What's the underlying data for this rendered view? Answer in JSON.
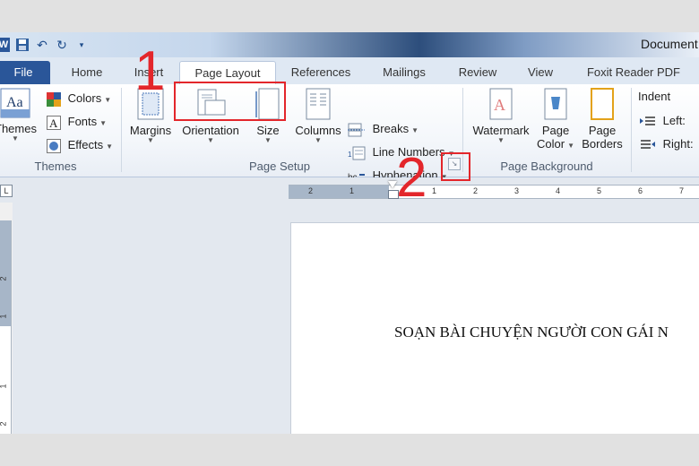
{
  "titlebar": {
    "document_title": "Document"
  },
  "qat": {
    "save_icon": "save-icon",
    "undo_icon": "undo-icon",
    "redo_icon": "redo-icon",
    "customize_icon": "customize-qat-icon"
  },
  "tabs": [
    {
      "label": "File"
    },
    {
      "label": "Home"
    },
    {
      "label": "Insert"
    },
    {
      "label": "Page Layout"
    },
    {
      "label": "References"
    },
    {
      "label": "Mailings"
    },
    {
      "label": "Review"
    },
    {
      "label": "View"
    },
    {
      "label": "Foxit Reader PDF"
    }
  ],
  "ribbon": {
    "themes": {
      "themes_label": "Themes",
      "colors_label": "Colors",
      "fonts_label": "Fonts",
      "effects_label": "Effects",
      "group_label": "Themes"
    },
    "page_setup": {
      "margins_label": "Margins",
      "orientation_label": "Orientation",
      "size_label": "Size",
      "columns_label": "Columns",
      "breaks_label": "Breaks",
      "line_numbers_label": "Line Numbers",
      "hyphenation_label": "Hyphenation",
      "group_label": "Page Setup"
    },
    "page_background": {
      "watermark_label": "Watermark",
      "page_color_label_1": "Page",
      "page_color_label_2": "Color",
      "page_borders_label_1": "Page",
      "page_borders_label_2": "Borders",
      "group_label": "Page Background"
    },
    "paragraph": {
      "indent_label": "Indent",
      "left_label": "Left:",
      "right_label": "Right:"
    }
  },
  "ruler": {
    "numbers": [
      "2",
      "1",
      "1",
      "2",
      "3",
      "4",
      "5",
      "6",
      "7"
    ],
    "vertical_numbers": [
      "2",
      "1",
      "1",
      "2"
    ]
  },
  "document": {
    "text": "SOẠN BÀI CHUYỆN NGƯỜI CON GÁI N"
  },
  "annotations": {
    "step1": "1",
    "step2": "2",
    "color": "#e3262b"
  }
}
